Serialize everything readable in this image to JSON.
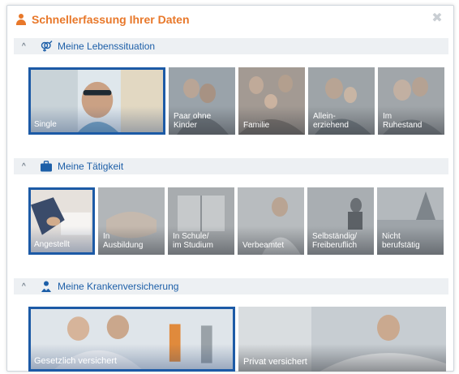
{
  "header": {
    "title": "Schnellerfassung Ihrer Daten"
  },
  "sections": {
    "lebenssituation": {
      "label": "Meine Lebenssituation",
      "tiles": [
        "Single",
        "Paar ohne\nKinder",
        "Familie",
        "Allein-\nerziehend",
        "Im\nRuhestand"
      ],
      "selected": "Single"
    },
    "taetigkeit": {
      "label": "Meine Tätigkeit",
      "tiles": [
        "Angestellt",
        "In\nAusbildung",
        "In Schule/\nim Studium",
        "Verbeamtet",
        "Selbständig/\nFreiberuflich",
        "Nicht\nberufstätig"
      ],
      "selected": "Angestellt"
    },
    "krankenversicherung": {
      "label": "Meine Krankenversicherung",
      "tiles": [
        "Gesetzlich versichert",
        "Privat versichert"
      ],
      "selected": "Gesetzlich versichert"
    }
  },
  "colors": {
    "accent": "#e8782a",
    "link": "#1d5fa8",
    "selected_border": "#1c5aa6"
  },
  "icons": {
    "header": "person-icon",
    "lebenssituation": "gender-icon",
    "taetigkeit": "briefcase-icon",
    "krankenversicherung": "doctor-icon",
    "close": "close-icon",
    "toggle": "chevron-up-icon"
  }
}
